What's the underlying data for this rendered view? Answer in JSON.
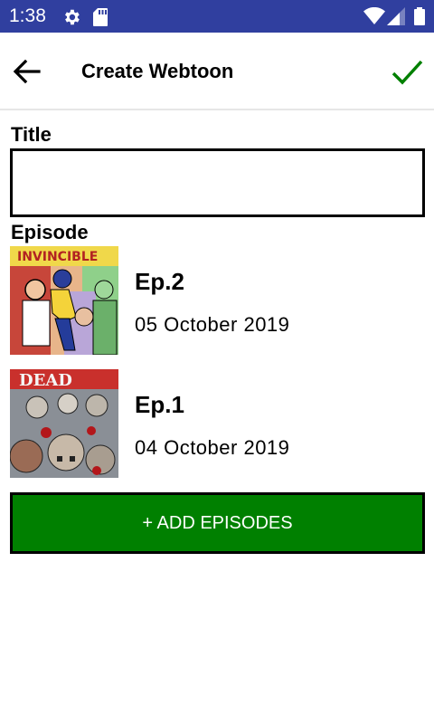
{
  "status_bar": {
    "time": "1:38",
    "background": "#303f9f",
    "icons": [
      "gear-icon",
      "sd-card-icon",
      "wifi-icon",
      "signal-icon",
      "battery-icon"
    ]
  },
  "app_bar": {
    "title": "Create Webtoon",
    "back_icon": "arrow-left-icon",
    "confirm_icon": "check-icon",
    "confirm_color": "#008000"
  },
  "form": {
    "title_label": "Title",
    "title_value": "",
    "episode_label": "Episode"
  },
  "episodes": [
    {
      "name": "Ep.2",
      "date": "05 October 2019",
      "thumbnail": "comic-cover-invincible"
    },
    {
      "name": "Ep.1",
      "date": "04 October 2019",
      "thumbnail": "comic-cover-walking-dead"
    }
  ],
  "add_button": {
    "label": "+ ADD EPISODES",
    "color": "#008000"
  }
}
